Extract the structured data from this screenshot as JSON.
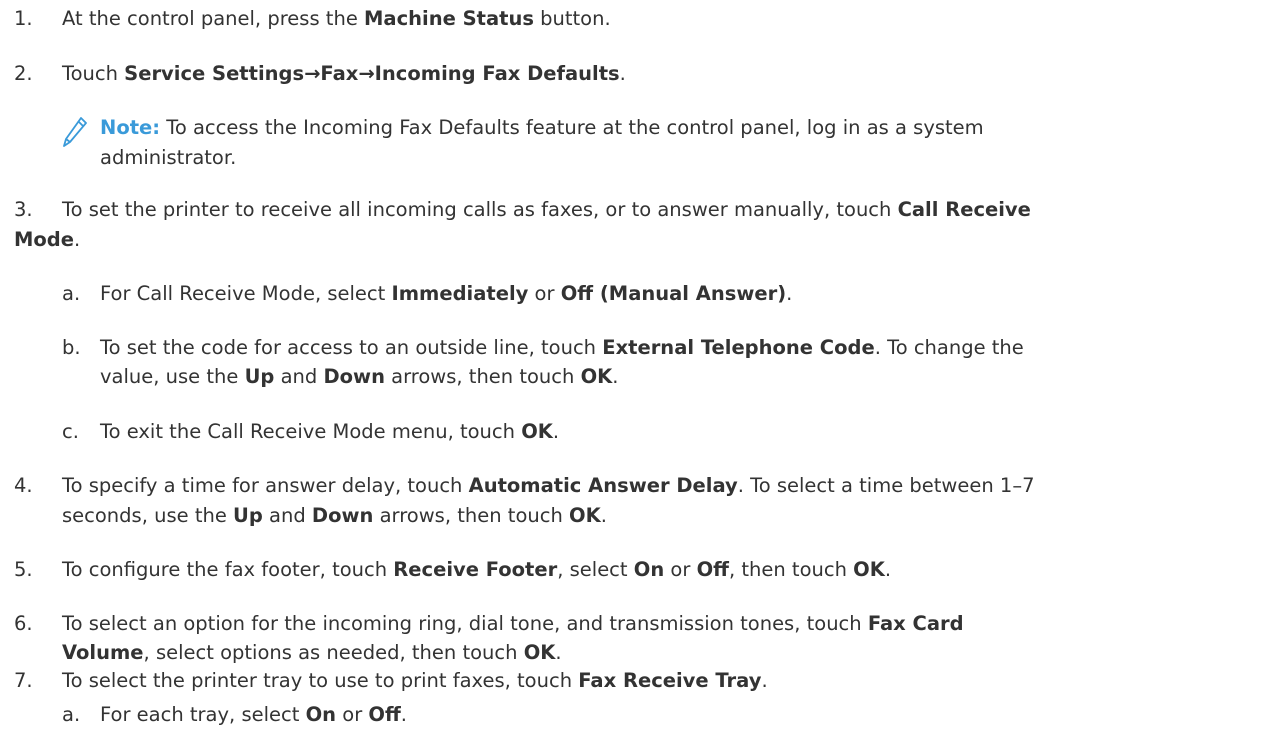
{
  "steps": [
    {
      "num": "1.",
      "pre": "At the control panel, press the ",
      "b1": "Machine Status",
      "post": " button."
    },
    {
      "num": "2.",
      "pre": "Touch ",
      "b1": "Service Settings→Fax→Incoming Fax Defaults",
      "post": "."
    },
    {
      "num": "3.",
      "line1_pre": "To set the printer to receive all incoming calls as faxes, or to answer manually, touch ",
      "line1_b": "Call Receive",
      "line2_b": "Mode",
      "line2_post": "."
    },
    {
      "num": "4.",
      "line1_pre": "To specify a time for answer delay, touch ",
      "line1_b": "Automatic Answer Delay",
      "line1_post": ". To select a time between 1–7",
      "line2_pre": "seconds, use the ",
      "line2_b1": "Up",
      "line2_mid": " and ",
      "line2_b2": "Down",
      "line2_mid2": " arrows, then touch ",
      "line2_b3": "OK",
      "line2_post": "."
    },
    {
      "num": "5.",
      "pre": "To configure the fax footer, touch ",
      "b1": "Receive Footer",
      "mid": ", select ",
      "b2": "On",
      "mid2": " or ",
      "b3": "Off",
      "mid3": ", then touch ",
      "b4": "OK",
      "post": "."
    },
    {
      "num": "6.",
      "line1_pre": "To select an option for the incoming ring, dial tone, and transmission tones, touch ",
      "line1_b": "Fax Card",
      "line2_b": "Volume",
      "line2_mid": ", select options as needed, then touch ",
      "line2_b2": "OK",
      "line2_post": "."
    },
    {
      "num": "7.",
      "pre": "To select the printer tray to use to print faxes, touch ",
      "b1": "Fax Receive Tray",
      "post": "."
    }
  ],
  "note": {
    "label": "Note:",
    "line1": " To access the Incoming Fax Defaults feature at the control panel, log in as a system",
    "line2": "administrator.",
    "icon": "pencil-icon"
  },
  "substeps3": [
    {
      "letter": "a.",
      "pre": "For Call Receive Mode, select ",
      "b1": "Immediately",
      "mid": " or ",
      "b2": "Off (Manual Answer)",
      "post": "."
    },
    {
      "letter": "b.",
      "line1_pre": "To set the code for access to an outside line, touch ",
      "line1_b": "External Telephone Code",
      "line1_post": ". To change the",
      "line2_pre": "value, use the ",
      "line2_b1": "Up",
      "line2_mid": " and ",
      "line2_b2": "Down",
      "line2_mid2": " arrows, then touch ",
      "line2_b3": "OK",
      "line2_post": "."
    },
    {
      "letter": "c.",
      "pre": "To exit the Call Receive Mode menu, touch ",
      "b1": "OK",
      "post": "."
    }
  ],
  "substeps7": [
    {
      "letter": "a.",
      "pre": "For each tray, select ",
      "b1": "On",
      "mid": " or ",
      "b2": "Off",
      "post": "."
    }
  ],
  "colors": {
    "text": "#333333",
    "accent": "#3a9ad9"
  }
}
